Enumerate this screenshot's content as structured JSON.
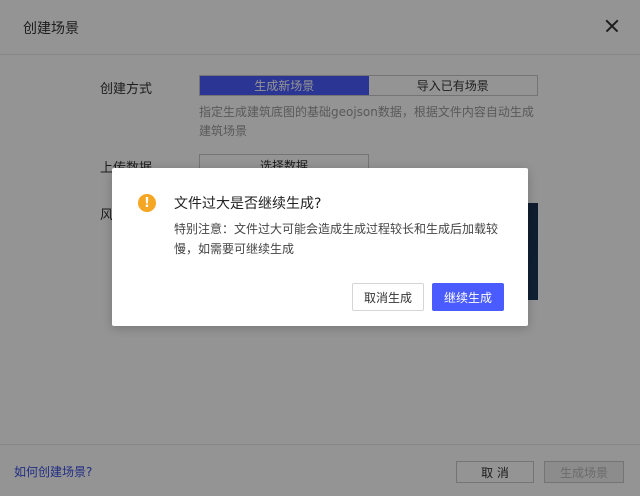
{
  "dialog": {
    "title": "创建场景",
    "close_icon": "close-icon"
  },
  "form": {
    "create_method_label": "创建方式",
    "segments": [
      "生成新场景",
      "导入已有场景"
    ],
    "active_segment": "生成新场景",
    "hint": "指定生成建筑底图的基础geojson数据，根据文件内容自动生成建筑场景",
    "upload_label": "上传数据",
    "select_button": "选择数据",
    "style_label": "风"
  },
  "footer": {
    "help_link": "如何创建场景?",
    "cancel": "取 消",
    "generate": "生成场景"
  },
  "confirm": {
    "icon": "warning-icon",
    "title": "文件过大是否继续生成?",
    "content": "特别注意：文件过大可能会造成生成过程较长和生成后加载较慢，如需要可继续生成",
    "cancel": "取消生成",
    "ok": "继续生成"
  },
  "colors": {
    "primary": "#4a5cff",
    "warning": "#f5a623"
  }
}
